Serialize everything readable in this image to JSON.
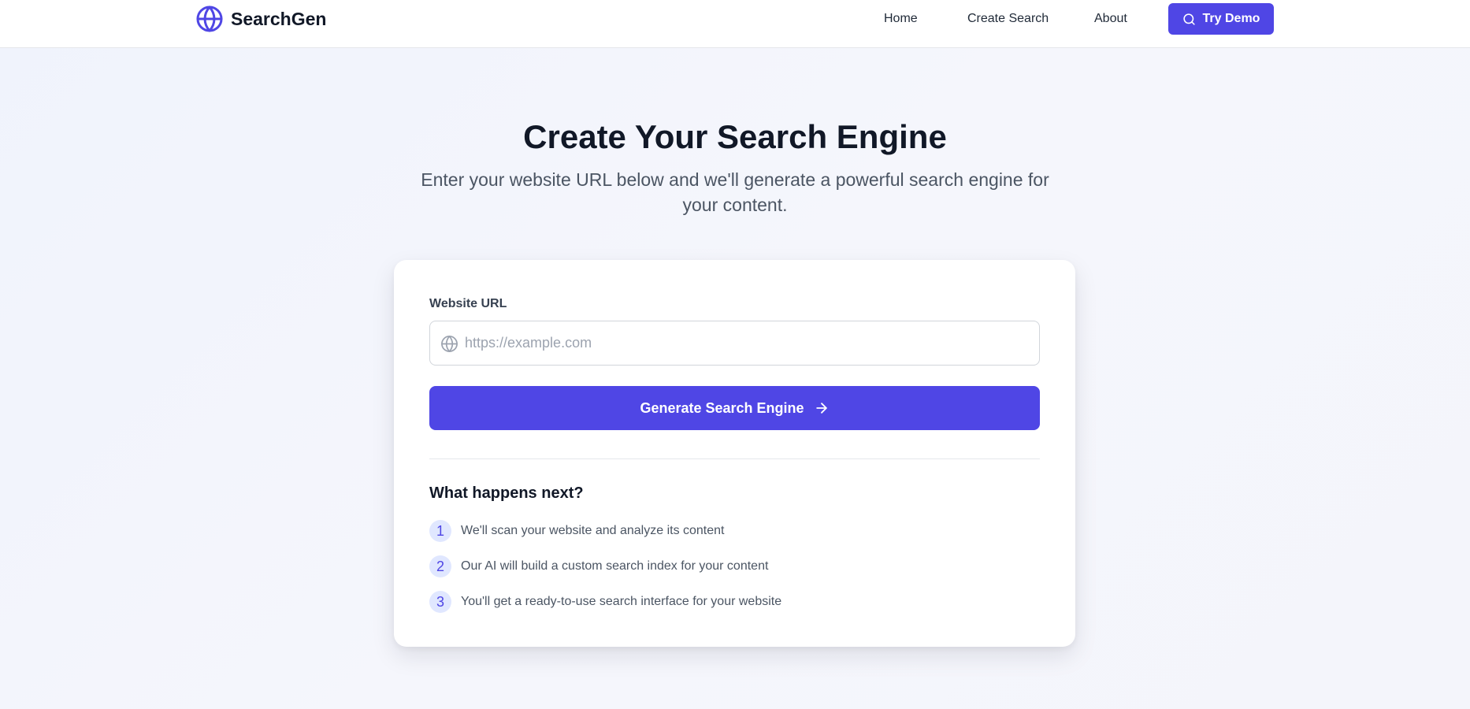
{
  "nav": {
    "brand": "SearchGen",
    "links": [
      "Home",
      "Create Search",
      "About"
    ],
    "demo_label": "Try Demo"
  },
  "hero": {
    "title": "Create Your Search Engine",
    "subtitle": "Enter your website URL below and we'll generate a powerful search engine for your content."
  },
  "form": {
    "url_label": "Website URL",
    "url_placeholder": "https://example.com",
    "url_value": "",
    "submit_label": "Generate Search Engine"
  },
  "next": {
    "title": "What happens next?",
    "steps": [
      {
        "num": "1",
        "text": "We'll scan your website and analyze its content"
      },
      {
        "num": "2",
        "text": "Our AI will build a custom search index for your content"
      },
      {
        "num": "3",
        "text": "You'll get a ready-to-use search interface for your website"
      }
    ]
  },
  "colors": {
    "accent": "#4f46e5",
    "accent_light": "#e0e7ff",
    "text_dark": "#111827",
    "text_muted": "#4b5563"
  },
  "icons": {
    "brand": "globe-icon",
    "demo": "search-icon",
    "url_field": "globe-icon",
    "submit": "arrow-right-icon"
  }
}
